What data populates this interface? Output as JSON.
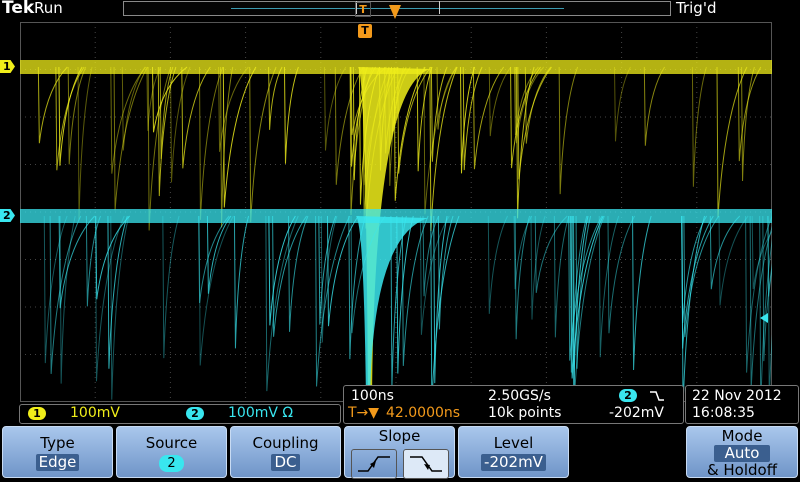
{
  "top": {
    "brand": "Tek",
    "run_state": "Run",
    "trigger_state": "Trig'd",
    "trigger_marker": "T"
  },
  "channels": {
    "ch1": {
      "number": "1",
      "scale": "100mV",
      "color": "#f0ee1a"
    },
    "ch2": {
      "number": "2",
      "scale": "100mV Ω",
      "color": "#39e6ef"
    }
  },
  "horizontal": {
    "timebase": "100ns",
    "sample_rate": "2.50GS/s",
    "trigger_position_icon": "T→▼",
    "trigger_position": "42.0000ns",
    "record_length": "10k points",
    "trigger_source": "2",
    "trigger_slope_icon": "falling-edge-icon",
    "trigger_level": "-202mV"
  },
  "datetime": {
    "date": "22 Nov 2012",
    "time": "16:08:35"
  },
  "menu": {
    "type": {
      "label": "Type",
      "value": "Edge"
    },
    "source": {
      "label": "Source",
      "value": "2"
    },
    "coupling": {
      "label": "Coupling",
      "value": "DC"
    },
    "slope": {
      "label": "Slope",
      "selected": "falling"
    },
    "level": {
      "label": "Level",
      "value": "-202mV"
    },
    "mode": {
      "label": "Mode",
      "value": "Auto",
      "value2": "& Holdoff"
    }
  },
  "colors": {
    "ch1": "#f0ee1a",
    "ch2": "#39e6ef",
    "trigger": "#f39a1b",
    "menu_button": "#8fb1de"
  }
}
